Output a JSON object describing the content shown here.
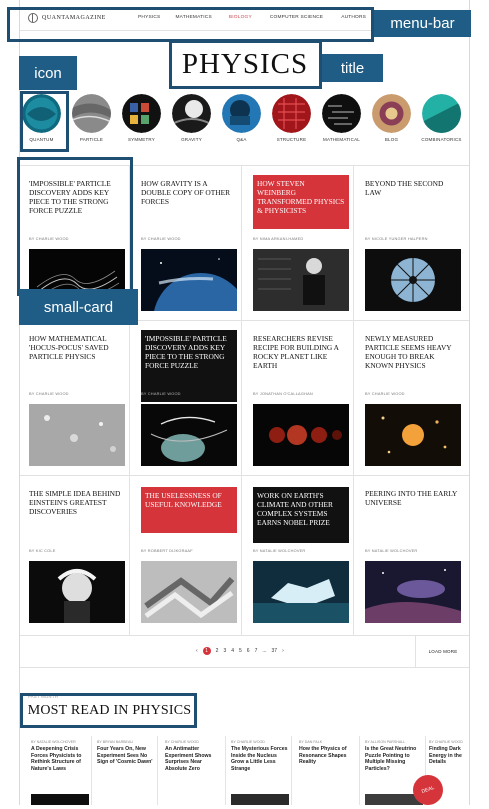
{
  "nav": {
    "logo": "QUANTAMAGAZINE",
    "items": [
      "PHYSICS",
      "MATHEMATICS",
      "BIOLOGY",
      "COMPUTER SCIENCE",
      "AUTHORS"
    ]
  },
  "title": "PHYSICS",
  "annotations": {
    "menu_bar": "menu-bar",
    "icon": "icon",
    "title": "title",
    "small_card": "small-card"
  },
  "topics": [
    {
      "label": "QUANTUM",
      "color": "#1f8ea0"
    },
    {
      "label": "PARTICLE",
      "color": "#7e7e7e"
    },
    {
      "label": "SYMMETRY",
      "color": "#3c4f7b"
    },
    {
      "label": "GRAVITY",
      "color": "#444444"
    },
    {
      "label": "Q&A",
      "color": "#2471a8"
    },
    {
      "label": "STRUCTURE",
      "color": "#b91f24"
    },
    {
      "label": "MATHEMATICAL",
      "color": "#222222"
    },
    {
      "label": "BLOG",
      "color": "#9d4a5b"
    },
    {
      "label": "COMBINATORICS",
      "color": "#2ba39f"
    }
  ],
  "cards": [
    {
      "title": "'IMPOSSIBLE' PARTICLE DISCOVERY ADDS KEY PIECE TO THE STRONG FORCE PUZZLE",
      "byline": "BY CHARLIE WOOD"
    },
    {
      "title": "HOW GRAVITY IS A DOUBLE COPY OF OTHER FORCES",
      "byline": "BY CHARLIE WOOD"
    },
    {
      "title": "HOW STEVEN WEINBERG TRANSFORMED PHYSICS & PHYSICISTS",
      "byline": "BY NIMA ARKANI-HAMED"
    },
    {
      "title": "BEYOND THE SECOND LAW",
      "byline": "BY NICOLE YUNGER HALPERN"
    },
    {
      "title": "HOW MATHEMATICAL 'HOCUS-POCUS' SAVED PARTICLE PHYSICS",
      "byline": "BY CHARLIE WOOD"
    },
    {
      "title": "'IMPOSSIBLE' PARTICLE DISCOVERY ADDS KEY PIECE TO THE STRONG FORCE PUZZLE",
      "byline": "BY CHARLIE WOOD"
    },
    {
      "title": "RESEARCHERS REVISE RECIPE FOR BUILDING A ROCKY PLANET LIKE EARTH",
      "byline": "BY JONATHAN O'CALLAGHAN"
    },
    {
      "title": "NEWLY MEASURED PARTICLE SEEMS HEAVY ENOUGH TO BREAK KNOWN PHYSICS",
      "byline": "BY CHARLIE WOOD"
    },
    {
      "title": "THE SIMPLE IDEA BEHIND EINSTEIN'S GREATEST DISCOVERIES",
      "byline": "BY KIC COLE"
    },
    {
      "title": "THE USELESSNESS OF USEFUL KNOWLEDGE",
      "byline": "BY ROBBERT DIJKGRAAF"
    },
    {
      "title": "WORK ON EARTH'S CLIMATE AND OTHER COMPLEX SYSTEMS EARNS NOBEL PRIZE",
      "byline": "BY NATALIE WOLCHOVER"
    },
    {
      "title": "PEERING INTO THE EARLY UNIVERSE",
      "byline": "BY NATALIE WOLCHOVER"
    }
  ],
  "pager": {
    "pages": [
      "1",
      "2",
      "3",
      "4",
      "5",
      "6",
      "7",
      "...",
      "37"
    ],
    "prev": "‹",
    "next": "›",
    "load_more": "LOAD MORE"
  },
  "most_read": {
    "kicker": "PAST MONTH",
    "title": "MOST READ IN PHYSICS",
    "items": [
      {
        "byline": "BY NATALIE WOLCHOVER",
        "text": "A Deepening Crisis Forces Physicists to Rethink Structure of Nature's Laws"
      },
      {
        "byline": "BY BRYAN BARBEAU",
        "text": "Four Years On, New Experiment Sees No Sign of 'Cosmic Dawn'"
      },
      {
        "byline": "BY CHARLIE WOOD",
        "text": "An Antimatter Experiment Shows Surprises Near Absolute Zero"
      },
      {
        "byline": "BY CHARLIE WOOD",
        "text": "The Mysterious Forces Inside the Nucleus Grow a Little Less Strange"
      },
      {
        "byline": "BY DAN FALK",
        "text": "How the Physics of Resonance Shapes Reality"
      },
      {
        "byline": "BY ALLISON PARSHALL",
        "text": "Is the Great Neutrino Puzzle Pointing to Multiple Missing Particles?"
      },
      {
        "byline": "BY CHARLIE WOOD",
        "text": "Finding Dark Energy in the Details"
      }
    ]
  },
  "badge": "DEAL",
  "colors": {
    "accent": "#d6343b",
    "annotation": "#1f5d86"
  }
}
